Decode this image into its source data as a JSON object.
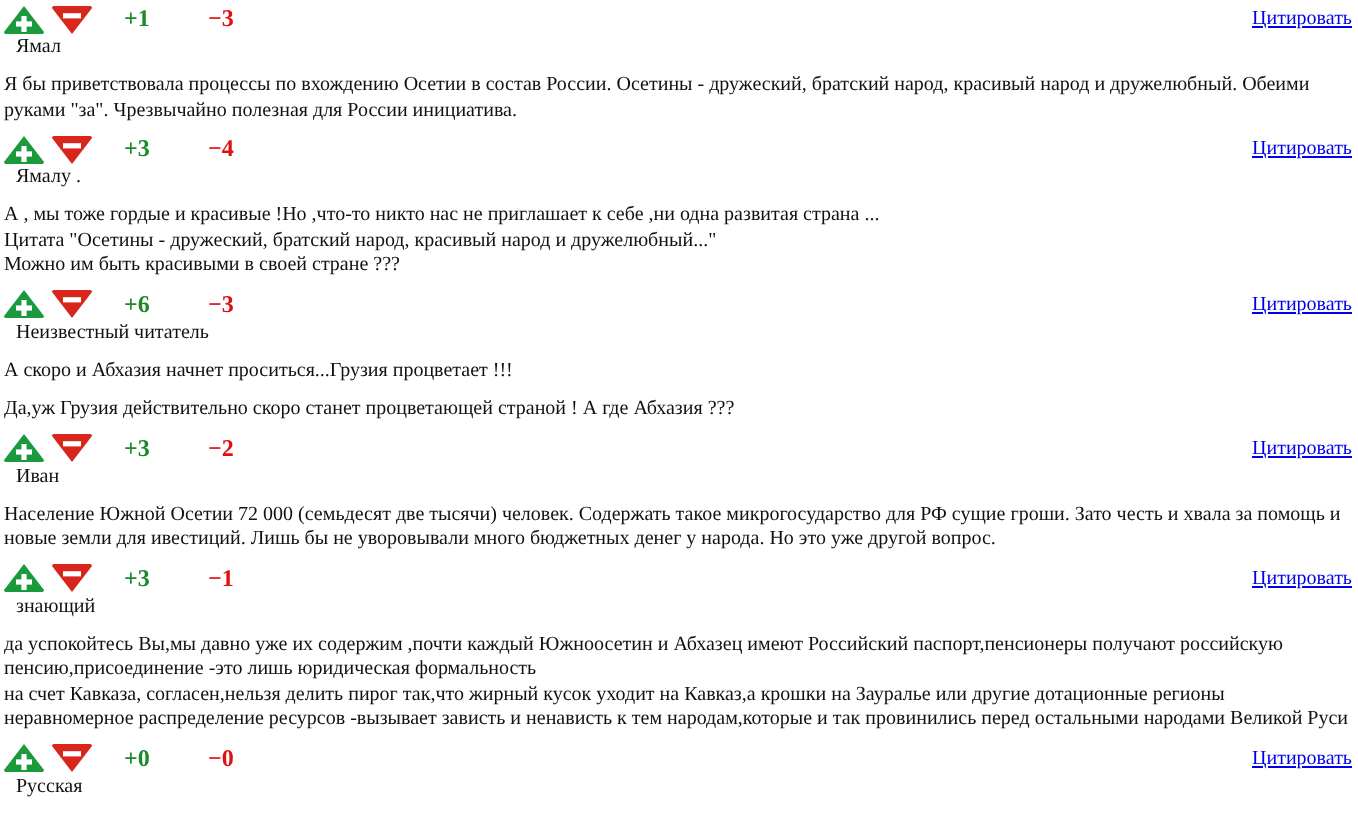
{
  "comments": [
    {
      "plus": "+1",
      "minus": "−3",
      "author": "Ямал",
      "quote_link": "Цитировать",
      "paragraphs": [
        [
          "Я бы приветствовала процессы по вхождению Осетии в состав России. Осетины - дружеский, братский народ, красивый народ и дружелюбный. Обеими руками \"за\". Чрезвычайно полезная для России инициатива."
        ]
      ]
    },
    {
      "plus": "+3",
      "minus": "−4",
      "author": "Ямалу .",
      "quote_link": "Цитировать",
      "paragraphs": [
        [
          "А , мы тоже гордые и красивые !Но ,что-то никто нас не приглашает к себе ,ни одна развитая страна ...",
          "Цитата \"Осетины - дружеский, братский народ, красивый народ и дружелюбный...\"",
          "Можно им быть красивыми в своей стране ???"
        ]
      ]
    },
    {
      "plus": "+6",
      "minus": "−3",
      "author": "Неизвестный читатель",
      "quote_link": "Цитировать",
      "paragraphs": [
        [
          "А скоро и Абхазия начнет проситься...Грузия процветает !!!"
        ],
        [
          "Да,уж Грузия действительно скоро станет процветающей страной ! А где Абхазия ???"
        ]
      ]
    },
    {
      "plus": "+3",
      "minus": "−2",
      "author": "Иван",
      "quote_link": "Цитировать",
      "paragraphs": [
        [
          "Население Южной Осетии 72 000 (семьдесят две тысячи) человек. Содержать такое микрогосударство для РФ сущие гроши. Зато честь и хвала за помощь и новые земли для ивестиций. Лишь бы не уворовывали много бюджетных денег у народа. Но это уже другой вопрос."
        ]
      ]
    },
    {
      "plus": "+3",
      "minus": "−1",
      "author": "знающий",
      "quote_link": "Цитировать",
      "paragraphs": [
        [
          "да успокойтесь Вы,мы давно уже их содержим ,почти каждый Южноосетин и Абхазец имеют Российский паспорт,пенсионеры получают российскую пенсию,присоединение -это лишь юридическая формальность",
          "на счет Кавказа, согласен,нельзя делить пирог так,что жирный кусок уходит на Кавказ,а крошки на Зауралье или другие дотационные регионы",
          "неравномерное распределение ресурсов -вызывает зависть и ненависть к тем народам,которые и так провинились перед остальными народами Великой Руси"
        ]
      ]
    },
    {
      "plus": "+0",
      "minus": "−0",
      "author": "Русская",
      "quote_link": "Цитировать"
    }
  ]
}
